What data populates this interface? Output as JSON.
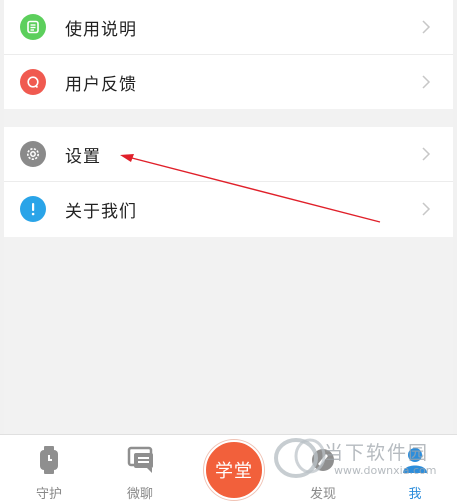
{
  "menu": {
    "items": [
      {
        "label": "使用说明",
        "icon": "manual-icon",
        "color": "#5ccf5c"
      },
      {
        "label": "用户反馈",
        "icon": "feedback-icon",
        "color": "#f05a50"
      },
      {
        "label": "设置",
        "icon": "settings-icon",
        "color": "#8a8a8a"
      },
      {
        "label": "关于我们",
        "icon": "info-icon",
        "color": "#2aa4e8"
      }
    ]
  },
  "tabbar": {
    "tabs": [
      {
        "label": "守护",
        "icon": "watch-icon"
      },
      {
        "label": "微聊",
        "icon": "chat-icon"
      },
      {
        "label": "学堂",
        "icon": "school-button"
      },
      {
        "label": "发现",
        "icon": "discover-icon"
      },
      {
        "label": "我",
        "icon": "profile-icon",
        "active": true
      }
    ],
    "active_color": "#2c8ddb",
    "center_color": "#f2603b"
  },
  "watermark": {
    "title": "当下软件园",
    "url": "www.downxia.com"
  },
  "annotation": {
    "color": "#e0202a"
  }
}
